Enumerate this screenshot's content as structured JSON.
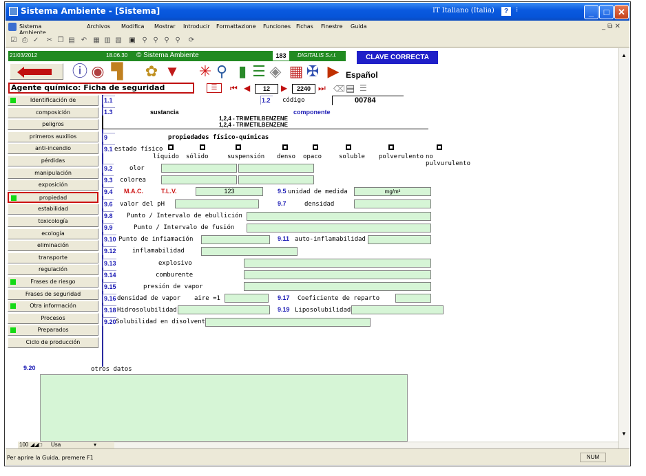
{
  "window": {
    "title": "Sistema Ambiente - [Sistema]",
    "language_indicator": "IT Italiano (Italia)"
  },
  "menubar": {
    "items": [
      "Sistema Ambiente",
      "Archivos",
      "Modifica",
      "Mostrar",
      "Introducir",
      "Formattazione",
      "Funciones",
      "Fichas",
      "Finestre",
      "Guida"
    ]
  },
  "header": {
    "date": "21/03/2012",
    "time": "18.06.30",
    "copyright": "© Sistema Ambiente",
    "counter": "183",
    "vendor": "DIGITALIS S.r.l.",
    "status": "CLAVE CORRECTA",
    "language": "Español"
  },
  "record": {
    "form_title": "Agente químico: Ficha de seguridad",
    "current": "12",
    "total": "2240"
  },
  "sidebar": {
    "items": [
      {
        "label": "Identificación de",
        "green": true,
        "active": false
      },
      {
        "label": "composición",
        "green": false,
        "active": false
      },
      {
        "label": "peligros",
        "green": false,
        "active": false
      },
      {
        "label": "primeros auxilios",
        "green": false,
        "active": false
      },
      {
        "label": "anti-incendio",
        "green": false,
        "active": false
      },
      {
        "label": "pérdidas",
        "green": false,
        "active": false
      },
      {
        "label": "manipulación",
        "green": false,
        "active": false
      },
      {
        "label": "exposición",
        "green": false,
        "active": false
      },
      {
        "label": "propiedad",
        "green": true,
        "active": true
      },
      {
        "label": "estabilidad",
        "green": false,
        "active": false
      },
      {
        "label": "toxicología",
        "green": false,
        "active": false
      },
      {
        "label": "ecología",
        "green": false,
        "active": false
      },
      {
        "label": "eliminación",
        "green": false,
        "active": false
      },
      {
        "label": "transporte",
        "green": false,
        "active": false
      },
      {
        "label": "regulación",
        "green": false,
        "active": false
      },
      {
        "label": "Frases de riesgo",
        "green": true,
        "active": false
      },
      {
        "label": "Frases de seguridad",
        "green": false,
        "active": false
      },
      {
        "label": "Otra información",
        "green": true,
        "active": false
      },
      {
        "label": "Procesos",
        "green": false,
        "active": false
      },
      {
        "label": "Preparados",
        "green": true,
        "active": false
      },
      {
        "label": "Ciclo de producción",
        "green": false,
        "active": false
      }
    ]
  },
  "form": {
    "n11": "1.1",
    "n12": "1.2",
    "codigo_label": "código",
    "codigo_value": "00784",
    "n13": "1.3",
    "sustancia_label": "sustancia",
    "componente_label": "componente",
    "sustancia_line1": "1,2,4 - TRIMETILBENZENE",
    "sustancia_line2": "1,2,4 - TRIMETILBENZENE",
    "n9": "9",
    "section_title": "propiedades físico-químicas",
    "n91": "9.1",
    "estado_label": "estado físico",
    "states": [
      "líquido",
      "sólido",
      "suspensión",
      "denso",
      "opaco",
      "soluble",
      "polverulento",
      "no pulvurulento"
    ],
    "n92": "9.2",
    "olor": "olor",
    "n93": "9.3",
    "colorea": "colorea",
    "n94": "9.4",
    "mac": "M.A.C.",
    "tlv": "T.L.V.",
    "tlv_value": "123",
    "n95": "9.5",
    "unidad_label": "unidad de medida",
    "unidad_value": "mg/m³",
    "n96": "9.6",
    "ph": "valor del pH",
    "n97": "9.7",
    "densidad": "densidad",
    "n98": "9.8",
    "ebullicion": "Punto / Intervalo de ebullición",
    "n99": "9.9",
    "fusion": "Punto / Intervalo de fusión",
    "n910": "9.10",
    "inflamacion": "Punto de infiamación",
    "n911": "9.11",
    "autoinflam": "auto-inflamabilidad",
    "n912": "9.12",
    "inflamabilidad": "inflamabilidad",
    "n913": "9.13",
    "explosivo": "explosivo",
    "n914": "9.14",
    "comburente": "comburente",
    "n915": "9.15",
    "presion": "presión de vapor",
    "n916": "9.16",
    "densidad_vapor": "densidad de vapor",
    "aire": "aire =1",
    "n917": "9.17",
    "coef": "Coeficiente de reparto",
    "n918": "9.18",
    "hidro": "Hidrosolubilidad",
    "n919": "9.19",
    "lipo": "Liposolubilidad",
    "n920a": "9.20",
    "solub": "Solubilidad en disolventes",
    "n920b": "9.20",
    "otros": "otros datos"
  },
  "bottom": {
    "zoom": "100",
    "sheet": "Usa"
  },
  "status": {
    "help": "Per aprire la Guida, premere F1",
    "num": "NUM"
  },
  "colors": {
    "titlebar": "#0654d8",
    "header_green": "#218a21",
    "clave_blue": "#1f1fc8",
    "field_green": "#d6f5d6",
    "label_blue": "#1c1cb5",
    "mac_red": "#cc1111"
  }
}
